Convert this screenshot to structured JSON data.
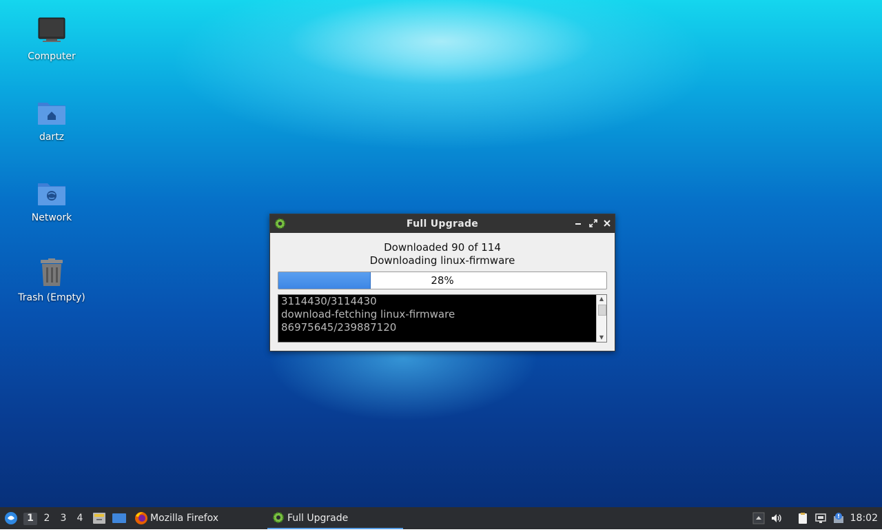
{
  "desktop": {
    "icons": [
      {
        "label": "Computer"
      },
      {
        "label": "dartz"
      },
      {
        "label": "Network"
      },
      {
        "label": "Trash (Empty)"
      }
    ]
  },
  "dialog": {
    "title": "Full Upgrade",
    "status_line_1": "Downloaded 90 of 114",
    "status_line_2": "Downloading linux-firmware",
    "progress_label": "28%",
    "progress_fraction": 0.28,
    "log_lines": [
      "3114430/3114430",
      "download-fetching linux-firmware",
      "86975645/239887120"
    ],
    "buttons": {
      "minimize": "minimize",
      "maximize": "maximize",
      "close": "close"
    }
  },
  "taskbar": {
    "workspaces": [
      "1",
      "2",
      "3",
      "4"
    ],
    "active_workspace": "1",
    "tasks": [
      {
        "label": "Mozilla Firefox",
        "icon": "firefox-icon"
      },
      {
        "label": "Full Upgrade",
        "icon": "gear-icon"
      }
    ],
    "clock": "18:02"
  },
  "colors": {
    "progress": "#3d86e5",
    "titlebar": "#333333",
    "taskbar": "#2b2d31"
  }
}
